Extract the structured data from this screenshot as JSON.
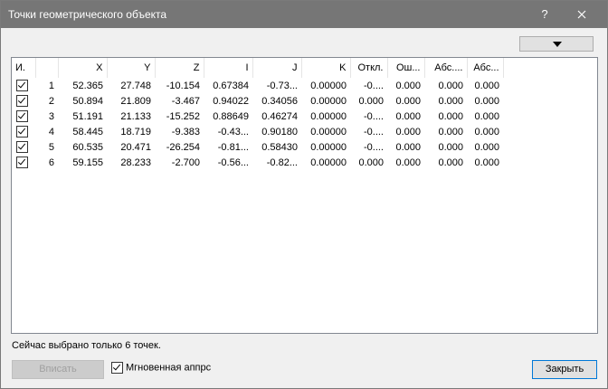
{
  "window": {
    "title": "Точки геометрического объекта",
    "help_label": "?",
    "close_label": "✕"
  },
  "table": {
    "headers": [
      "И.",
      "",
      "X",
      "Y",
      "Z",
      "I",
      "J",
      "K",
      "Откл.",
      "Ош...",
      "Абс....",
      "Абс..."
    ],
    "rows": [
      {
        "num": "1",
        "x": "52.365",
        "y": "27.748",
        "z": "-10.154",
        "i": "0.67384",
        "j": "-0.73...",
        "k": "0.00000",
        "dev": "-0....",
        "err": "0.000",
        "abs1": "0.000",
        "abs2": "0.000",
        "checked": true
      },
      {
        "num": "2",
        "x": "50.894",
        "y": "21.809",
        "z": "-3.467",
        "i": "0.94022",
        "j": "0.34056",
        "k": "0.00000",
        "dev": "0.000",
        "err": "0.000",
        "abs1": "0.000",
        "abs2": "0.000",
        "checked": true
      },
      {
        "num": "3",
        "x": "51.191",
        "y": "21.133",
        "z": "-15.252",
        "i": "0.88649",
        "j": "0.46274",
        "k": "0.00000",
        "dev": "-0....",
        "err": "0.000",
        "abs1": "0.000",
        "abs2": "0.000",
        "checked": true
      },
      {
        "num": "4",
        "x": "58.445",
        "y": "18.719",
        "z": "-9.383",
        "i": "-0.43...",
        "j": "0.90180",
        "k": "0.00000",
        "dev": "-0....",
        "err": "0.000",
        "abs1": "0.000",
        "abs2": "0.000",
        "checked": true
      },
      {
        "num": "5",
        "x": "60.535",
        "y": "20.471",
        "z": "-26.254",
        "i": "-0.81...",
        "j": "0.58430",
        "k": "0.00000",
        "dev": "-0....",
        "err": "0.000",
        "abs1": "0.000",
        "abs2": "0.000",
        "checked": true
      },
      {
        "num": "6",
        "x": "59.155",
        "y": "28.233",
        "z": "-2.700",
        "i": "-0.56...",
        "j": "-0.82...",
        "k": "0.00000",
        "dev": "0.000",
        "err": "0.000",
        "abs1": "0.000",
        "abs2": "0.000",
        "checked": true
      }
    ]
  },
  "status_text": "Сейчас выбрано только 6 точек.",
  "buttons": {
    "insert_label": "Вписать",
    "close_label": "Закрыть"
  },
  "instant_fit": {
    "label": "Мгновенная аппрс",
    "checked": true
  }
}
